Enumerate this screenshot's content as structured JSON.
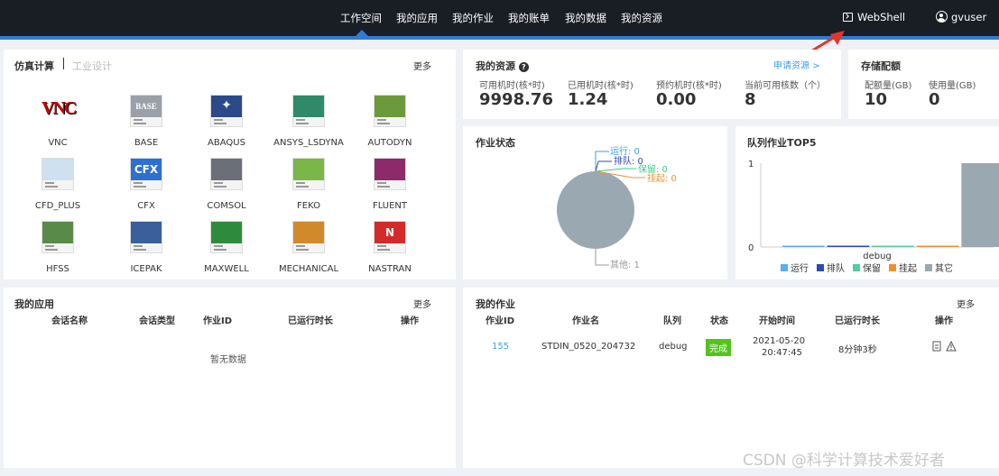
{
  "nav": {
    "items": [
      "工作空间",
      "我的应用",
      "我的作业",
      "我的账单",
      "我的数据",
      "我的资源"
    ],
    "active": 0,
    "webshell": "WebShell",
    "username": "gvuser"
  },
  "sim": {
    "title": "仿真计算",
    "title_alt": "工业设计",
    "more": "更多",
    "apps": [
      {
        "label": "VNC",
        "icon": "vnc-icon",
        "color": "#c40000"
      },
      {
        "label": "BASE",
        "icon": "base-icon",
        "color": "#9aa0a8"
      },
      {
        "label": "ABAQUS",
        "icon": "abaqus-icon",
        "color": "#2c4a8a"
      },
      {
        "label": "ANSYS_LSDYNA",
        "icon": "ansys-lsdyna-icon",
        "color": "#2f8a6a"
      },
      {
        "label": "AUTODYN",
        "icon": "autodyn-icon",
        "color": "#6c9a3a"
      },
      {
        "label": "CFD_PLUS",
        "icon": "cfd-plus-icon",
        "color": "#cfe0ef"
      },
      {
        "label": "CFX",
        "icon": "cfx-icon",
        "color": "#2d6fd2"
      },
      {
        "label": "COMSOL",
        "icon": "comsol-icon",
        "color": "#6a6f78"
      },
      {
        "label": "FEKO",
        "icon": "feko-icon",
        "color": "#7ab648"
      },
      {
        "label": "FLUENT",
        "icon": "fluent-icon",
        "color": "#8c2a6a"
      },
      {
        "label": "HFSS",
        "icon": "hfss-icon",
        "color": "#5a8a4a"
      },
      {
        "label": "ICEPAK",
        "icon": "icepak-icon",
        "color": "#3a5f9a"
      },
      {
        "label": "MAXWELL",
        "icon": "maxwell-icon",
        "color": "#2e8b3e"
      },
      {
        "label": "MECHANICAL",
        "icon": "mechanical-icon",
        "color": "#d08a2a"
      },
      {
        "label": "NASTRAN",
        "icon": "nastran-icon",
        "color": "#d42a2a"
      }
    ]
  },
  "res": {
    "title": "我的资源",
    "apply_link": "申请资源 >",
    "items": [
      {
        "label": "可用机时(核*时)",
        "value": "9998.76",
        "color": "#3aa0e8"
      },
      {
        "label": "已用机时(核*时)",
        "value": "1.24",
        "color": "#e8503a"
      },
      {
        "label": "预约机时(核*时)",
        "value": "0.00",
        "color": "#f0a020"
      },
      {
        "label": "当前可用核数（个）",
        "value": "8",
        "color": "#52c41a"
      }
    ]
  },
  "storage": {
    "title": "存储配额",
    "items": [
      {
        "label": "配额量(GB)",
        "value": "10",
        "color": "#3aa0e8"
      },
      {
        "label": "使用量(GB)",
        "value": "0",
        "color": "#e8503a"
      }
    ]
  },
  "jobstate": {
    "title": "作业状态",
    "labels": [
      {
        "text": "运行: 0",
        "color": "#3aa0e8"
      },
      {
        "text": "排队: 0",
        "color": "#2c4ab8"
      },
      {
        "text": "保留: 0",
        "color": "#3cc88a"
      },
      {
        "text": "挂起: 0",
        "color": "#f0902a"
      },
      {
        "text": "其他: 1",
        "color": "#999999"
      }
    ]
  },
  "top5": {
    "title": "队列作业TOP5"
  },
  "chart_data": {
    "type": "bar",
    "title": "队列作业TOP5",
    "categories": [
      "debug"
    ],
    "series": [
      {
        "name": "运行",
        "values": [
          0
        ],
        "color": "#5aaef0"
      },
      {
        "name": "排队",
        "values": [
          0
        ],
        "color": "#2c4ab8"
      },
      {
        "name": "保留",
        "values": [
          0
        ],
        "color": "#4cd0a0"
      },
      {
        "name": "挂起",
        "values": [
          0
        ],
        "color": "#f0902a"
      },
      {
        "name": "其它",
        "values": [
          1
        ],
        "color": "#9aa8b2"
      }
    ],
    "yticks": [
      "0",
      "1"
    ],
    "ylim": [
      0,
      1
    ]
  },
  "myapps": {
    "title": "我的应用",
    "more": "更多",
    "headers": [
      "会话名称",
      "会话类型",
      "作业ID",
      "已运行时长",
      "操作"
    ],
    "empty": "暂无数据"
  },
  "myjobs": {
    "title": "我的作业",
    "more": "更多",
    "headers": [
      "作业ID",
      "作业名",
      "队列",
      "状态",
      "开始时间",
      "已运行时长",
      "操作"
    ],
    "rows": [
      {
        "id": "155",
        "name": "STDIN_0520_204732",
        "queue": "debug",
        "status": "完成",
        "start_date": "2021-05-20",
        "start_time": "20:47:45",
        "elapsed": "8分钟3秒"
      }
    ]
  },
  "watermark": "CSDN @科学计算技术爱好者"
}
